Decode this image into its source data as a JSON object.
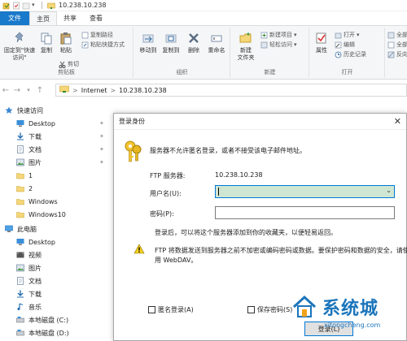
{
  "window": {
    "title": "10.238.10.238"
  },
  "tabs": [
    {
      "label": "文件"
    },
    {
      "label": "主页"
    },
    {
      "label": "共享"
    },
    {
      "label": "查看"
    }
  ],
  "ribbon": {
    "clipboard": {
      "pin_label": "固定到\"快速访问\"",
      "copy_label": "复制",
      "paste_label": "粘贴",
      "copy_path_label": "复制路径",
      "paste_shortcut_label": "粘贴快捷方式",
      "cut_label": "剪切",
      "group_label": "剪贴板"
    },
    "organize": {
      "move_to_label": "移动到",
      "copy_to_label": "复制到",
      "delete_label": "删除",
      "rename_label": "重命名",
      "group_label": "组织"
    },
    "new": {
      "new_folder_label": "新建\n文件夹",
      "new_item_label": "新建项目",
      "easy_access_label": "轻松访问",
      "group_label": "新建"
    },
    "open": {
      "properties_label": "属性",
      "open_label": "打开",
      "edit_label": "编辑",
      "history_label": "历史记录",
      "group_label": "打开"
    },
    "select": {
      "select_all_label": "全部选",
      "select_none_label": "全部取",
      "invert_label": "反向选"
    }
  },
  "address": {
    "segments": [
      "Internet",
      "10.238.10.238"
    ],
    "separator": ">"
  },
  "nav": {
    "quick_access": "快速访问",
    "quick_items": [
      {
        "label": "Desktop",
        "icon": "desktop-icon",
        "pinned": true
      },
      {
        "label": "下载",
        "icon": "download-icon",
        "pinned": true
      },
      {
        "label": "文档",
        "icon": "document-icon",
        "pinned": true
      },
      {
        "label": "图片",
        "icon": "picture-icon",
        "pinned": true
      },
      {
        "label": "1",
        "icon": "folder-icon",
        "pinned": false
      },
      {
        "label": "2",
        "icon": "folder-icon",
        "pinned": false
      },
      {
        "label": "Windows",
        "icon": "folder-icon",
        "pinned": false
      },
      {
        "label": "Windows10",
        "icon": "folder-icon",
        "pinned": false
      }
    ],
    "this_pc": "此电脑",
    "pc_items": [
      {
        "label": "Desktop",
        "icon": "desktop-icon"
      },
      {
        "label": "视频",
        "icon": "video-icon"
      },
      {
        "label": "图片",
        "icon": "picture-icon"
      },
      {
        "label": "文档",
        "icon": "document-icon"
      },
      {
        "label": "下载",
        "icon": "download-icon"
      },
      {
        "label": "音乐",
        "icon": "music-icon"
      },
      {
        "label": "本地磁盘 (C:)",
        "icon": "drive-icon"
      },
      {
        "label": "本地磁盘 (D:)",
        "icon": "drive-icon"
      }
    ]
  },
  "dialog": {
    "title": "登录身份",
    "message": "服务器不允许匿名登录，或者不接受该电子邮件地址。",
    "server_label": "FTP 服务器:",
    "server_value": "10.238.10.238",
    "username_label": "用户名(U):",
    "username_value": "",
    "password_label": "密码(P):",
    "password_value": "",
    "note": "登录后，可以将这个服务器添加到你的收藏夹，以便轻易返回。",
    "warning_line1": "FTP 将数据发送到服务器之前不加密或编码密码或数据。要保护密码和数据的安全，请使",
    "warning_line2": "用 WebDAV。",
    "anonymous_label": "匿名登录(A)",
    "save_password_label": "保存密码(S)",
    "login_label": "登录(L)"
  },
  "watermark": {
    "brand": "系统城",
    "url": "xitongcheng.com"
  }
}
